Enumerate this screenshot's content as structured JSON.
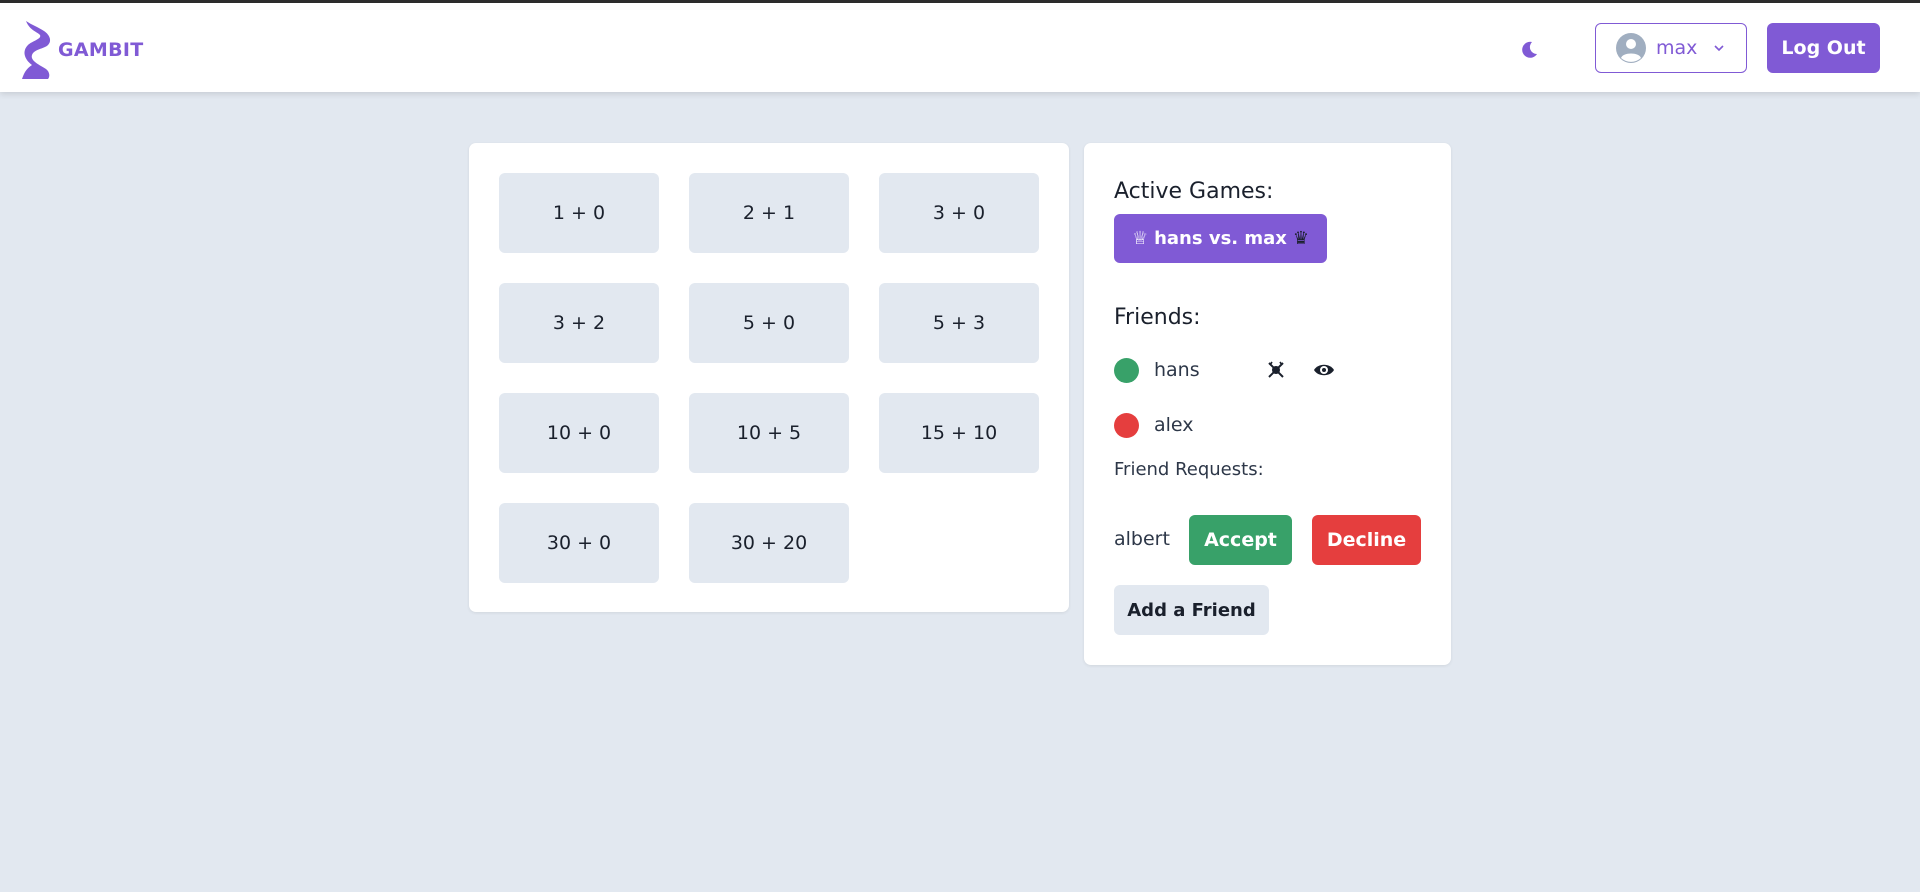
{
  "app": {
    "logo_text": "GAMBIT",
    "accent": "#805ad5"
  },
  "header": {
    "theme_icon": "moon-icon",
    "user": {
      "name": "max",
      "avatar_icon": "user-avatar-icon",
      "chevron_icon": "chevron-down-icon"
    },
    "logout_label": "Log Out"
  },
  "time_controls": [
    "1 + 0",
    "2 + 1",
    "3 + 0",
    "3 + 2",
    "5 + 0",
    "5 + 3",
    "10 + 0",
    "10 + 5",
    "15 + 10",
    "30 + 0",
    "30 + 20"
  ],
  "sidebar": {
    "active_games_heading": "Active Games:",
    "active_game": {
      "label": "hans vs. max",
      "prefix": "♕",
      "suffix": "♛"
    },
    "friends_heading": "Friends:",
    "friends": [
      {
        "name": "hans",
        "status": "online",
        "status_color": "#38a169",
        "actions": [
          "challenge-icon",
          "spectate-eye-icon"
        ]
      },
      {
        "name": "alex",
        "status": "offline",
        "status_color": "#e53e3e"
      }
    ],
    "requests_heading": "Friend Requests:",
    "requests": [
      {
        "name": "albert",
        "accept_label": "Accept",
        "decline_label": "Decline"
      }
    ],
    "add_friend_label": "Add a Friend"
  }
}
